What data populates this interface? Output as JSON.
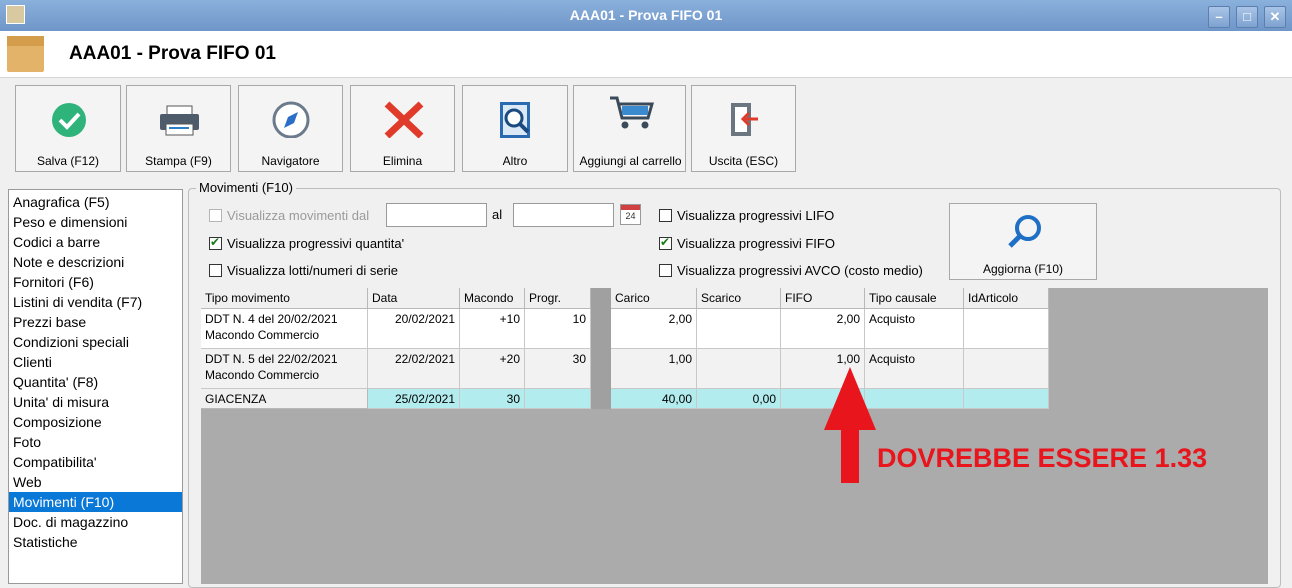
{
  "window": {
    "title": "AAA01 - Prova FIFO 01",
    "header_title": "AAA01 - Prova FIFO 01",
    "min": "–",
    "max": "□",
    "close": "✕"
  },
  "toolbar": [
    {
      "label": "Salva (F12)",
      "icon": "check-icon"
    },
    {
      "label": "Stampa (F9)",
      "icon": "printer-icon"
    },
    {
      "label": "Navigatore",
      "icon": "compass-icon"
    },
    {
      "label": "Elimina",
      "icon": "x-icon"
    },
    {
      "label": "Altro",
      "icon": "search-book-icon"
    },
    {
      "label": "Aggiungi al carrello",
      "icon": "cart-icon"
    },
    {
      "label": "Uscita (ESC)",
      "icon": "exit-icon"
    }
  ],
  "nav": {
    "items": [
      "Anagrafica (F5)",
      "Peso e dimensioni",
      "Codici a barre",
      "Note e descrizioni",
      "Fornitori (F6)",
      "Listini di vendita (F7)",
      "Prezzi base",
      "Condizioni speciali",
      "Clienti",
      "Quantita' (F8)",
      "Unita' di misura",
      "Composizione",
      "Foto",
      "Compatibilita'",
      "Web",
      "Movimenti (F10)",
      "Doc. di magazzino",
      "Statistiche"
    ],
    "selected": "Movimenti (F10)"
  },
  "movimenti": {
    "group_label": "Movimenti (F10)",
    "dal_label": "Visualizza movimenti dal",
    "al_label": "al",
    "calendar_day": "24",
    "quantita_label": "Visualizza progressivi quantita'",
    "lotti_label": "Visualizza lotti/numeri di serie",
    "lifo_label": "Visualizza progressivi LIFO",
    "fifo_label": "Visualizza progressivi FIFO",
    "avco_label": "Visualizza progressivi AVCO (costo medio)",
    "refresh_label": "Aggiorna (F10)"
  },
  "grid": {
    "headers": [
      "Tipo movimento",
      "Data",
      "Macondo",
      "Progr.",
      "Carico",
      "Scarico",
      "FIFO",
      "Tipo causale",
      "IdArticolo"
    ],
    "rows": [
      {
        "tipo1": "DDT N. 4 del 20/02/2021",
        "tipo2": "Macondo Commercio",
        "data": "20/02/2021",
        "macondo": "+10",
        "progr": "10",
        "carico": "2,00",
        "scarico": "",
        "fifo": "2,00",
        "causale": "Acquisto",
        "id": ""
      },
      {
        "tipo1": "DDT N. 5 del 22/02/2021",
        "tipo2": "Macondo Commercio",
        "data": "22/02/2021",
        "macondo": "+20",
        "progr": "30",
        "carico": "1,00",
        "scarico": "",
        "fifo": "1,00",
        "causale": "Acquisto",
        "id": ""
      }
    ],
    "total": {
      "tipo": "GIACENZA",
      "data": "25/02/2021",
      "macondo": "30",
      "carico": "40,00",
      "scarico": "0,00"
    }
  },
  "annotation": {
    "text": "DOVREBBE ESSERE 1.33",
    "color": "#e8151d"
  }
}
